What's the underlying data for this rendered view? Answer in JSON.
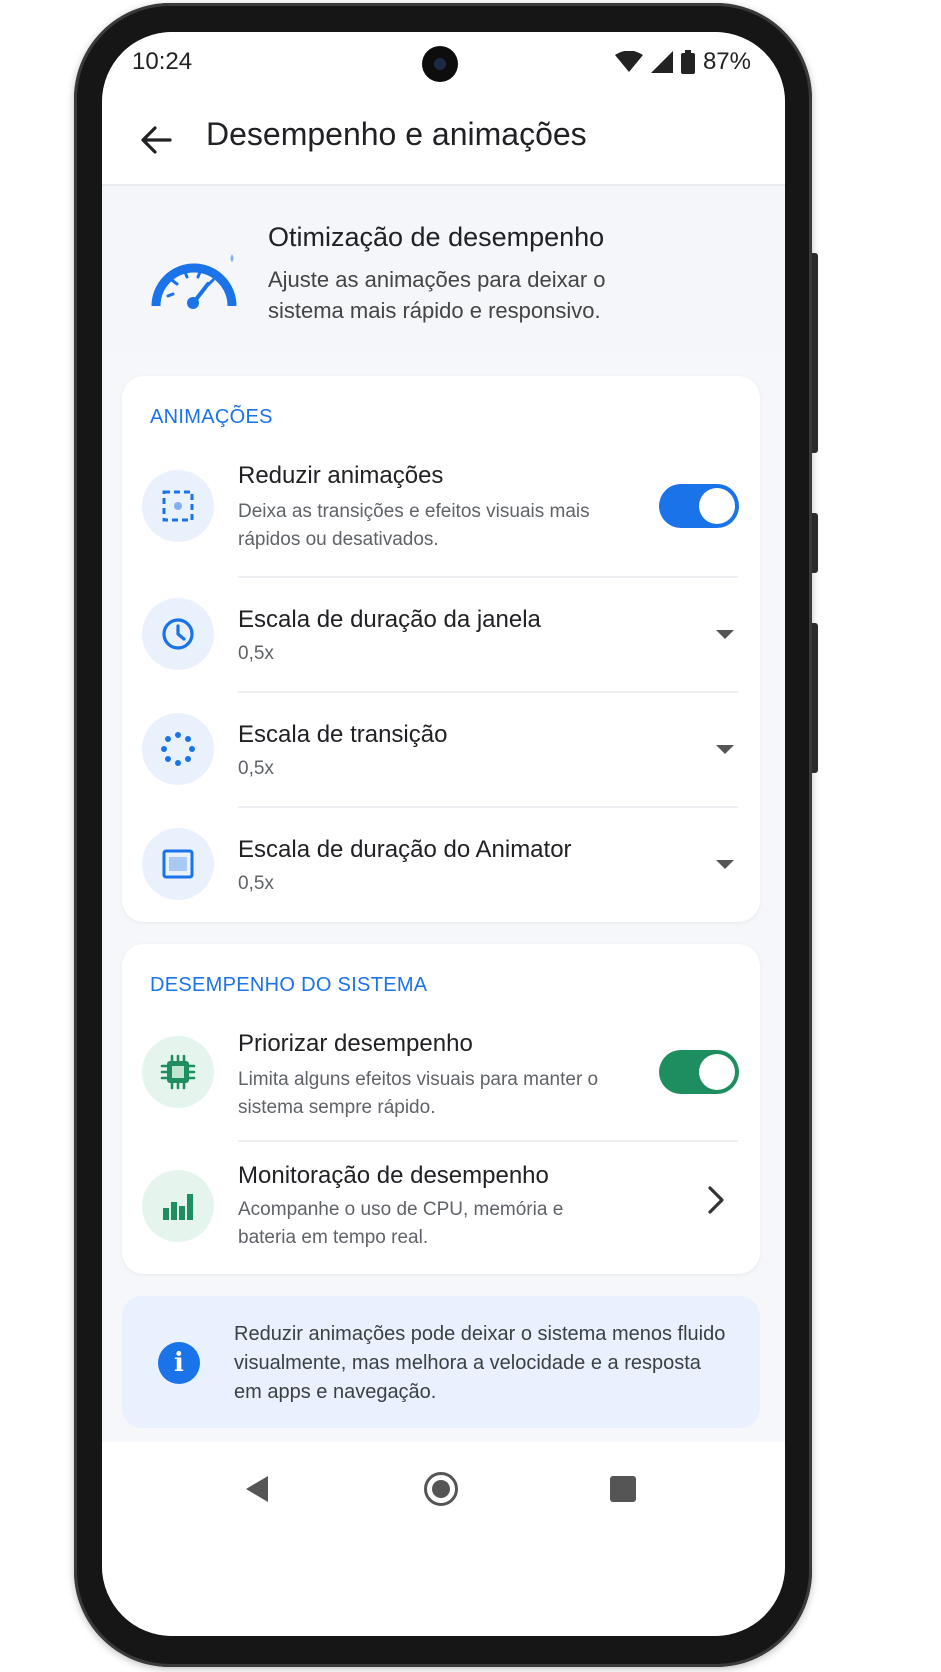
{
  "status_bar": {
    "time": "10:24",
    "battery_text": "87%"
  },
  "app_bar": {
    "title": "Desempenho e animações",
    "back_icon": "arrow-back-icon"
  },
  "hero": {
    "icon": "speedometer-icon",
    "title": "Otimização de desempenho",
    "subtitle": "Ajuste as animações para deixar o sistema mais rápido e responsivo."
  },
  "animations_section": {
    "header": "ANIMAÇÕES",
    "reduce": {
      "icon": "dashed-frame-icon",
      "title": "Reduzir animações",
      "subtitle": "Deixa as transições e efeitos visuais mais rápidos ou desativados.",
      "enabled": true
    },
    "window_scale": {
      "icon": "clock-icon",
      "title": "Escala de duração da janela",
      "value": "0,5x"
    },
    "transition_scale": {
      "icon": "dotted-circle-icon",
      "title": "Escala de transição",
      "value": "0,5x"
    },
    "animator_scale": {
      "icon": "window-frame-icon",
      "title": "Escala de duração do Animator",
      "value": "0,5x"
    }
  },
  "system_section": {
    "header": "DESEMPENHO DO SISTEMA",
    "prioritize": {
      "icon": "chip-icon",
      "title": "Priorizar desempenho",
      "subtitle": "Limita alguns efeitos visuais para manter o sistema sempre rápido.",
      "enabled": true
    },
    "monitoring": {
      "icon": "bar-chart-icon",
      "title": "Monitoração de desempenho",
      "subtitle": "Acompanhe o uso de CPU, memória e bateria em tempo real."
    }
  },
  "info_banner": {
    "icon": "info-icon",
    "glyph": "i",
    "text": "Reduzir animações pode deixar o sistema menos fluido visualmente, mas melhora a velocidade e a resposta em apps e navegação."
  },
  "colors": {
    "accent_blue": "#1a73e8",
    "accent_green": "#1e8e5e"
  }
}
